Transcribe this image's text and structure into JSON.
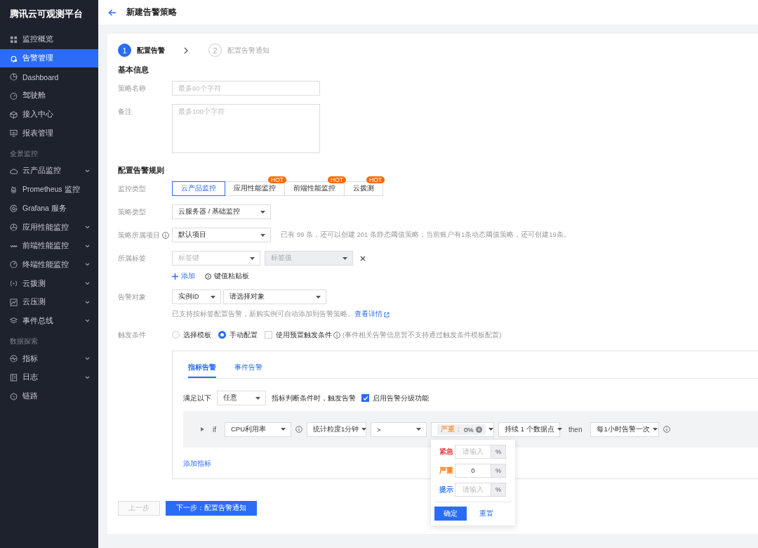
{
  "sidebar": {
    "title": "腾讯云可观测平台",
    "items": [
      {
        "kind": "item",
        "label": "监控概览",
        "selected": false,
        "expandable": false
      },
      {
        "kind": "item",
        "label": "告警管理",
        "selected": true,
        "expandable": false
      },
      {
        "kind": "item",
        "label": "Dashboard",
        "selected": false,
        "expandable": false
      },
      {
        "kind": "item",
        "label": "驾驶舱",
        "selected": false,
        "expandable": false
      },
      {
        "kind": "item",
        "label": "接入中心",
        "selected": false,
        "expandable": false
      },
      {
        "kind": "item",
        "label": "报表管理",
        "selected": false,
        "expandable": false
      },
      {
        "kind": "section",
        "label": "全景监控"
      },
      {
        "kind": "item",
        "label": "云产品监控",
        "selected": false,
        "expandable": true
      },
      {
        "kind": "item",
        "label": "Prometheus 监控",
        "selected": false,
        "expandable": false
      },
      {
        "kind": "item",
        "label": "Grafana 服务",
        "selected": false,
        "expandable": false
      },
      {
        "kind": "item",
        "label": "应用性能监控",
        "selected": false,
        "expandable": true
      },
      {
        "kind": "item",
        "label": "前端性能监控",
        "selected": false,
        "expandable": true
      },
      {
        "kind": "item",
        "label": "终端性能监控",
        "selected": false,
        "expandable": true
      },
      {
        "kind": "item",
        "label": "云拨测",
        "selected": false,
        "expandable": true
      },
      {
        "kind": "item",
        "label": "云压测",
        "selected": false,
        "expandable": true
      },
      {
        "kind": "item",
        "label": "事件总线",
        "selected": false,
        "expandable": true
      },
      {
        "kind": "section",
        "label": "数据探索"
      },
      {
        "kind": "item",
        "label": "指标",
        "selected": false,
        "expandable": true
      },
      {
        "kind": "item",
        "label": "日志",
        "selected": false,
        "expandable": true
      },
      {
        "kind": "item",
        "label": "链路",
        "selected": false,
        "expandable": false
      }
    ]
  },
  "header": {
    "title": "新建告警策略"
  },
  "steps": [
    {
      "number": "1",
      "label": "配置告警",
      "selected": true
    },
    {
      "number": "2",
      "label": "配置告警通知",
      "selected": false
    }
  ],
  "basic": {
    "title": "基本信息",
    "name_label": "策略名称",
    "name_placeholder": "最多60个字符",
    "note_label": "备注",
    "note_placeholder": "最多100个字符"
  },
  "rules": {
    "title": "配置告警规则",
    "monitor_type": {
      "label": "监控类型",
      "options": [
        {
          "label": "云产品监控",
          "selected": true
        },
        {
          "label": "应用性能监控",
          "selected": false,
          "badge": "HOT"
        },
        {
          "label": "前端性能监控",
          "selected": false,
          "badge": "HOT"
        },
        {
          "label": "云拨测",
          "selected": false,
          "badge": "HOT"
        }
      ]
    },
    "policy_type": {
      "label": "策略类型",
      "value": "云服务器 / 基础监控"
    },
    "project": {
      "label": "策略所属项目",
      "value": "默认项目",
      "hint": "已有 99 条，还可以创建 201 条静态阈值策略；当前账户有1条动态阈值策略，还可创建19条。"
    },
    "tags": {
      "label": "所属标签",
      "key_placeholder": "标签键",
      "value_placeholder": "标签值",
      "value_disabled": true,
      "add": "添加",
      "paste": "键值粘贴板"
    },
    "target": {
      "label": "告警对象",
      "type": "实例ID",
      "placeholder": "请选择对象",
      "hint": "已支持按标签配置告警，新购实例可自动添加到告警策略。",
      "link": "查看详情"
    },
    "trigger": {
      "label": "触发条件",
      "options": [
        {
          "label": "选择模板",
          "selected": false
        },
        {
          "label": "手动配置",
          "selected": true
        }
      ],
      "preset": {
        "label": "使用预置触发条件",
        "checked": false,
        "note": "(事件相关告警信息暂不支持通过触发条件模板配置)"
      }
    }
  },
  "panel": {
    "tabs": [
      {
        "label": "指标告警",
        "selected": true
      },
      {
        "label": "事件告警",
        "selected": false
      }
    ],
    "satisfy_label": "满足以下",
    "satisfy_value": "任意",
    "satisfy_text": "指标判断条件时，触发告警",
    "grading": {
      "label": "启用告警分级功能",
      "checked": true
    },
    "condition": {
      "if": "if",
      "metric": "CPU利用率",
      "period": "统计粒度1分钟",
      "operator": ">",
      "threshold_level": "严重：",
      "threshold_value": "0%",
      "duration": "持续 1 个数据点",
      "then": "then",
      "frequency": "每1小时告警一次"
    },
    "add_metric": "添加指标"
  },
  "popover": {
    "levels": [
      {
        "label": "紧急",
        "color": "#e54545",
        "placeholder": "请输入",
        "unit": "%"
      },
      {
        "label": "严重",
        "color": "#ff7200",
        "value": "0",
        "unit": "%"
      },
      {
        "label": "提示",
        "color": "#3a7bff",
        "placeholder": "请输入",
        "unit": "%"
      }
    ],
    "confirm": "确定",
    "reset": "重置"
  },
  "footer": {
    "prev": "上一步",
    "prev_disabled": true,
    "next": "下一步：配置告警通知"
  }
}
